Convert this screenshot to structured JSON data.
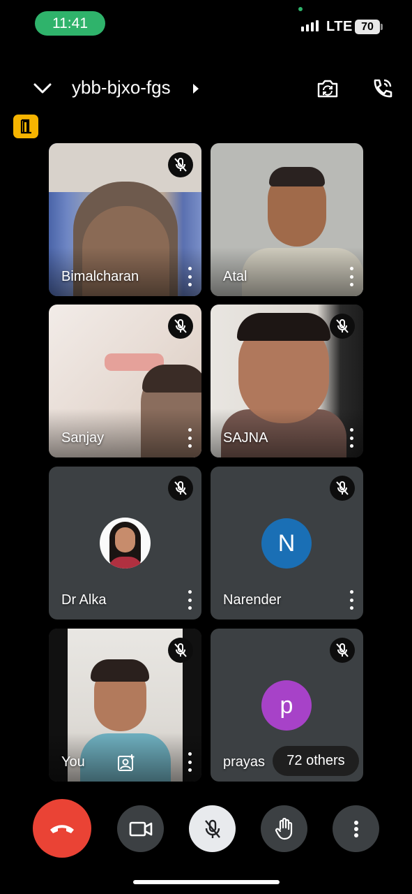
{
  "status_bar": {
    "time": "11:41",
    "network": "LTE",
    "battery": "70"
  },
  "header": {
    "meeting_code": "ybb-bjxo-fgs"
  },
  "participants": [
    {
      "name": "Bimalcharan"
    },
    {
      "name": "Atal"
    },
    {
      "name": "Sanjay"
    },
    {
      "name": "SAJNA"
    },
    {
      "name": "Dr Alka"
    },
    {
      "name": "Narender",
      "initial": "N",
      "avatar_color": "#1a6fb5"
    },
    {
      "name": "You"
    },
    {
      "name": "prayas",
      "initial": "p",
      "avatar_color": "#a742c8",
      "others_label": "72 others"
    }
  ],
  "colors": {
    "end_call": "#ea4335",
    "tile_bg": "#3c4043",
    "accent_green": "#2fb36b",
    "warning": "#f6b400"
  },
  "icons": [
    "chevron-down-icon",
    "chevron-right-icon",
    "camera-switch-icon",
    "phone-audio-icon",
    "door-icon",
    "mic-off-icon",
    "more-vert-icon",
    "end-call-icon",
    "video-icon",
    "hand-raise-icon",
    "add-person-icon"
  ]
}
